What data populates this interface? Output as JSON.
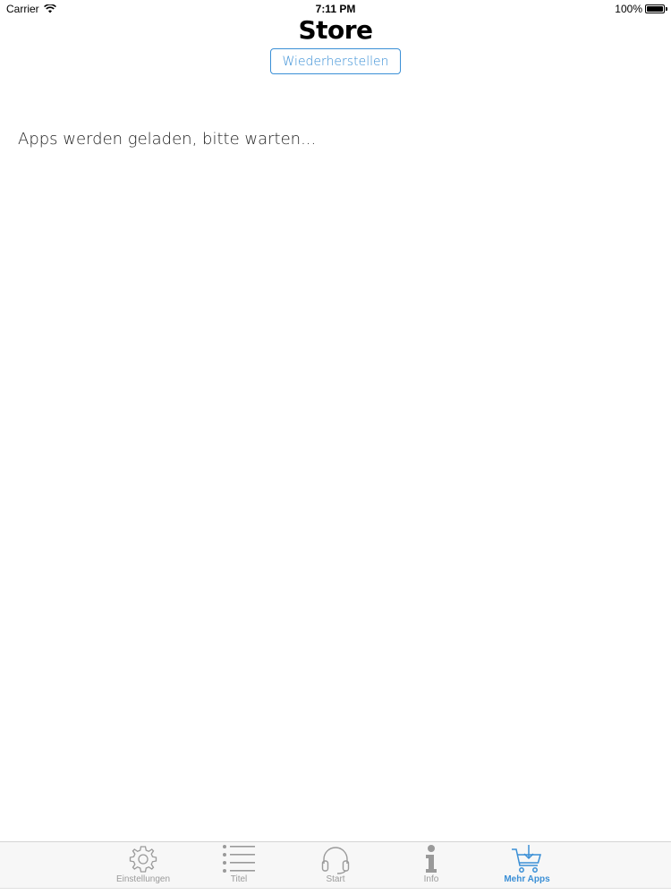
{
  "status_bar": {
    "carrier": "Carrier",
    "time": "7:11 PM",
    "battery": "100%"
  },
  "header": {
    "title": "Store",
    "restore_label": "Wiederherstellen"
  },
  "main": {
    "loading_text": "Apps werden geladen, bitte warten..."
  },
  "tab_bar": {
    "tabs": [
      {
        "label": "Einstellungen",
        "icon": "gear-icon"
      },
      {
        "label": "Titel",
        "icon": "list-icon"
      },
      {
        "label": "Start",
        "icon": "headphones-icon"
      },
      {
        "label": "Info",
        "icon": "info-icon"
      },
      {
        "label": "Mehr Apps",
        "icon": "cart-download-icon",
        "active": true
      }
    ],
    "active_color": "#3a8fd6",
    "inactive_color": "#9a9a9a"
  }
}
